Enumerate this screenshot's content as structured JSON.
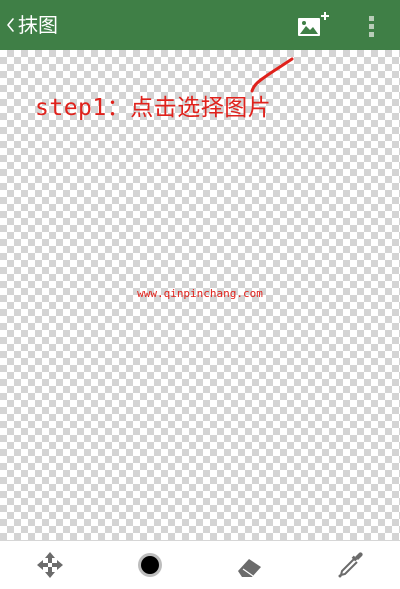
{
  "header": {
    "back_icon": "chevron-left-icon",
    "title": "抹图",
    "add_image_icon": "add-image-icon",
    "more_icon": "more-vert-icon",
    "color": "#3f7f46"
  },
  "canvas": {
    "annotation": "step1：点击选择图片",
    "watermark": "www.qinpinchang.com",
    "annotation_color": "#e0221c"
  },
  "toolbar": {
    "tools": [
      {
        "name": "move",
        "icon": "move-arrows-icon"
      },
      {
        "name": "brush",
        "icon": "brush-dot-icon"
      },
      {
        "name": "eraser",
        "icon": "eraser-icon"
      },
      {
        "name": "color-picker",
        "icon": "eyedropper-icon"
      }
    ]
  }
}
